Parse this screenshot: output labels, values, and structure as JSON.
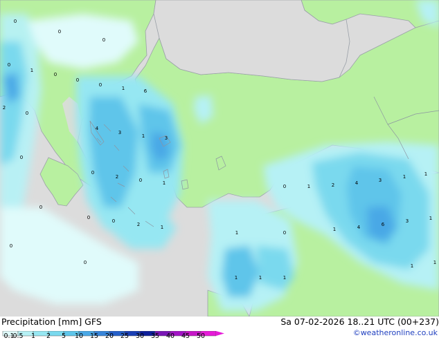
{
  "header": {
    "title": "Precipitation [mm] GFS",
    "datetime": "Sa 07-02-2026 18..21 UTC (00+237)",
    "credit": "©weatheronline.co.uk"
  },
  "legend": {
    "ticks": [
      "0.1",
      "0.5",
      "1",
      "2",
      "5",
      "10",
      "15",
      "20",
      "25",
      "30",
      "35",
      "40",
      "45",
      "50"
    ],
    "colors": [
      "#e0fbfb",
      "#b6f1f5",
      "#96e7f2",
      "#7ad9ee",
      "#5ec5ea",
      "#4aa8e6",
      "#3785d9",
      "#2560c9",
      "#1a3fb5",
      "#0e1f9a",
      "#7a16b6",
      "#a214c5",
      "#c616c8",
      "#e61ad8"
    ]
  },
  "map_labels": [
    "0",
    "0",
    "0",
    "0",
    "1",
    "0",
    "0",
    "0",
    "1",
    "6",
    "0",
    "2",
    "4",
    "3",
    "1",
    "3",
    "0",
    "0",
    "2",
    "0",
    "1",
    "0",
    "0",
    "0",
    "2",
    "1",
    "1",
    "0",
    "1",
    "2",
    "4",
    "3",
    "1",
    "1",
    "0",
    "1",
    "4",
    "6",
    "3",
    "1",
    "1",
    "1",
    "0",
    "0",
    "1",
    "1",
    "1"
  ],
  "colors": {
    "sea": "#dcdcdc",
    "land": "#b8f0a0",
    "coast": "#9aa0a8"
  }
}
